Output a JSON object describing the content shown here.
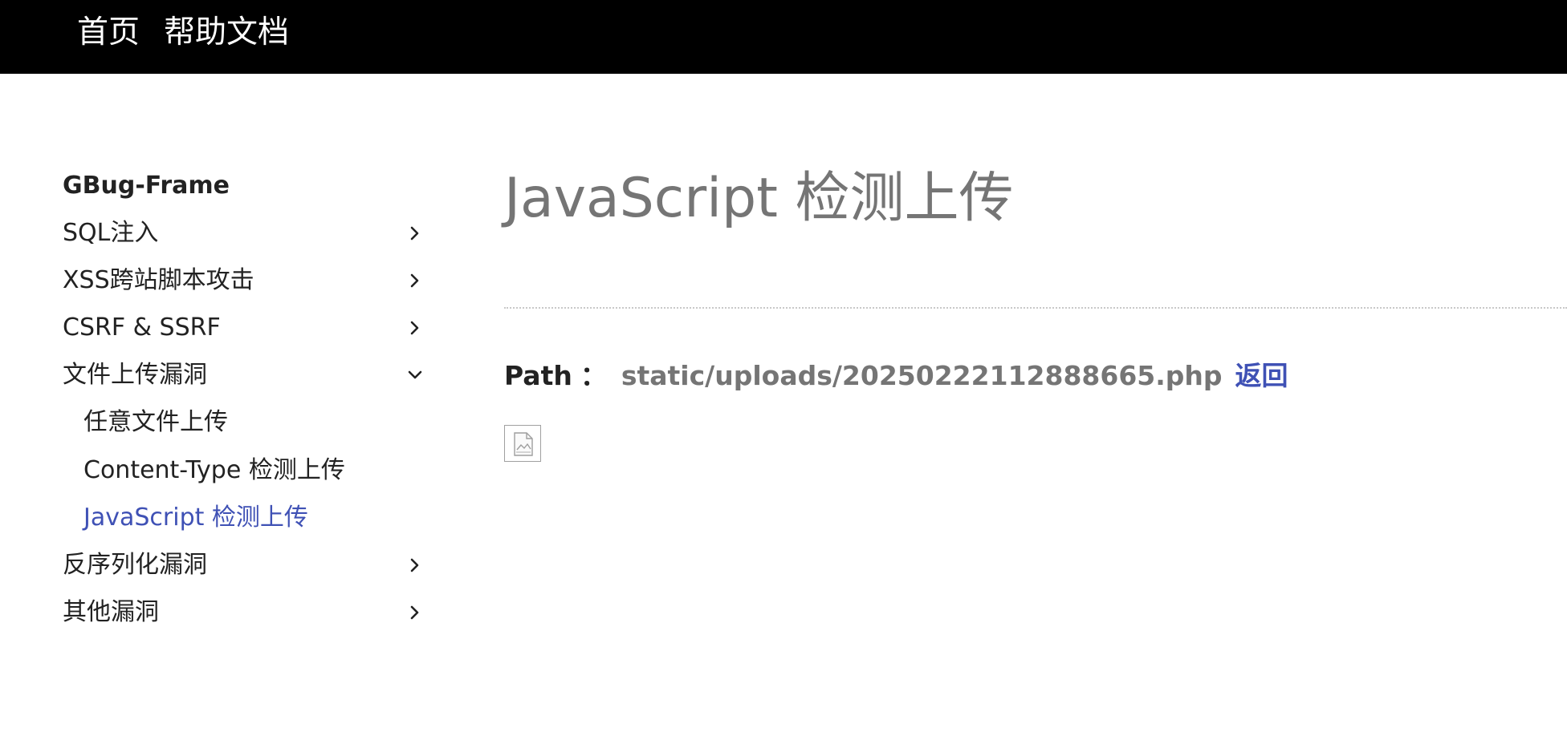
{
  "topnav": {
    "home": "首页",
    "docs": "帮助文档"
  },
  "sidebar": {
    "brand": "GBug-Frame",
    "items": [
      {
        "label": "SQL注入",
        "icon": "chevron-right-icon"
      },
      {
        "label": "XSS跨站脚本攻击",
        "icon": "chevron-right-icon"
      },
      {
        "label": "CSRF & SSRF",
        "icon": "chevron-right-icon"
      },
      {
        "label": "文件上传漏洞",
        "icon": "chevron-down-icon",
        "expanded": true
      },
      {
        "label": "反序列化漏洞",
        "icon": "chevron-right-icon"
      },
      {
        "label": "其他漏洞",
        "icon": "chevron-right-icon"
      }
    ],
    "subitems": [
      {
        "label": "任意文件上传"
      },
      {
        "label": "Content-Type 检测上传"
      },
      {
        "label": "JavaScript 检测上传",
        "active": true
      }
    ]
  },
  "main": {
    "title": "JavaScript 检测上传",
    "path_label": "Path",
    "path_separator": "：",
    "path_value": "static/uploads/20250222112888665.php",
    "back_label": "返回",
    "image_icon": "broken-image-icon"
  },
  "colors": {
    "topbar": "#000000",
    "accent": "#3f51b5",
    "title_gray": "#757575",
    "text": "#222222"
  }
}
